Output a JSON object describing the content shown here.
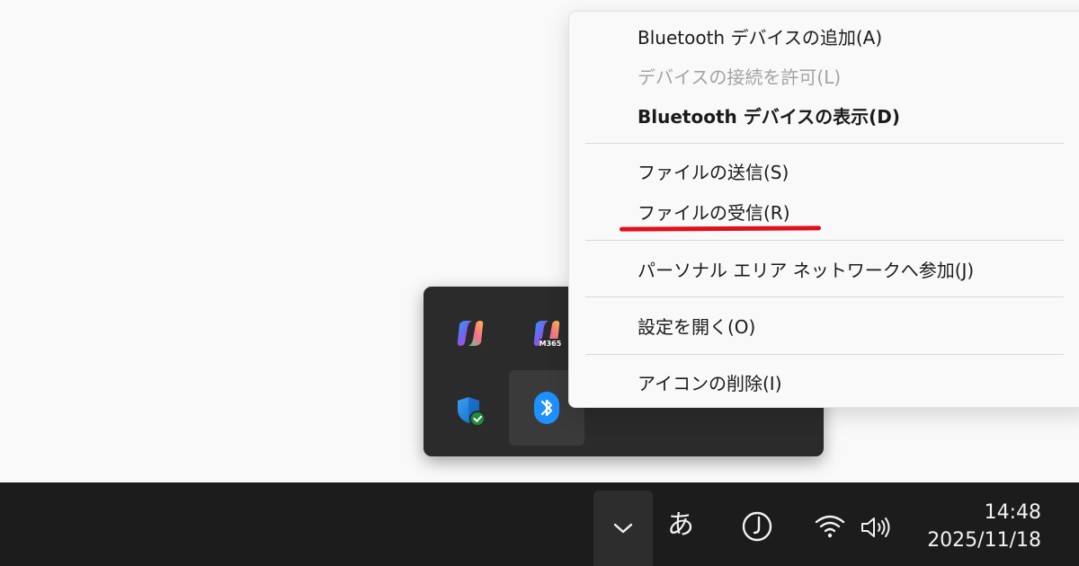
{
  "context_menu": {
    "items": [
      {
        "label": "Bluetooth デバイスの追加(A)",
        "enabled": true,
        "bold": false
      },
      {
        "label": "デバイスの接続を許可(L)",
        "enabled": false,
        "bold": false
      },
      {
        "label": "Bluetooth デバイスの表示(D)",
        "enabled": true,
        "bold": true
      },
      {
        "label": "ファイルの送信(S)",
        "enabled": true,
        "bold": false
      },
      {
        "label": "ファイルの受信(R)",
        "enabled": true,
        "bold": false,
        "highlighted": true
      },
      {
        "label": "パーソナル エリア ネットワークへ参加(J)",
        "enabled": true,
        "bold": false
      },
      {
        "label": "設定を開く(O)",
        "enabled": true,
        "bold": false
      },
      {
        "label": "アイコンの削除(I)",
        "enabled": true,
        "bold": false
      }
    ],
    "highlight_color": "#e0101d"
  },
  "tray_flyout": {
    "icons": [
      {
        "name": "copilot-icon"
      },
      {
        "name": "copilot-m365-icon",
        "badge": "M365"
      },
      {
        "name": "windows-security-icon"
      },
      {
        "name": "bluetooth-icon",
        "selected": true
      }
    ]
  },
  "taskbar": {
    "ime_label": "あ",
    "clock_time": "14:48",
    "clock_date": "2025/11/18",
    "icons": [
      "chevron-up-icon",
      "focus-assist-icon",
      "wifi-icon",
      "volume-icon"
    ]
  },
  "colors": {
    "taskbar_bg": "#1c1c1c",
    "flyout_bg": "#2b2b2b",
    "bluetooth_blue": "#1e90ff",
    "disabled_text": "#a3a3a3"
  }
}
